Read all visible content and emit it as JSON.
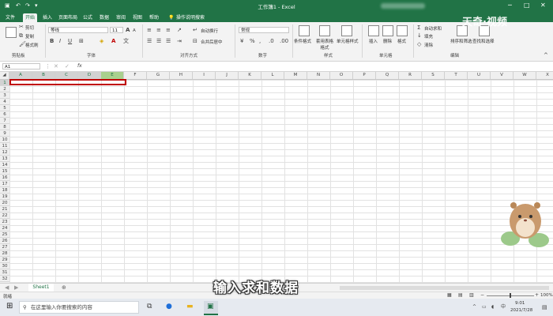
{
  "window": {
    "title": "工作簿1 - Excel"
  },
  "menu": {
    "tabs": [
      "文件",
      "开始",
      "插入",
      "页面布局",
      "公式",
      "数据",
      "审阅",
      "视图",
      "帮助"
    ],
    "active": 1,
    "search_hint": "操作说明搜索"
  },
  "ribbon": {
    "clipboard": {
      "cut": "剪切",
      "copy": "复制",
      "format_painter": "格式刷",
      "label": "剪贴板"
    },
    "font": {
      "name": "等线",
      "size": "11",
      "bold": "B",
      "italic": "I",
      "underline": "U",
      "grow": "A",
      "shrink": "A",
      "label": "字体"
    },
    "alignment": {
      "wrap": "自动换行",
      "merge": "合并后居中",
      "label": "对齐方式"
    },
    "number": {
      "format": "常规",
      "label": "数字"
    },
    "styles": {
      "conditional": "条件格式",
      "table_fmt": "套用表格格式",
      "cell_style": "单元格样式",
      "label": "样式"
    },
    "cells": {
      "insert": "插入",
      "delete": "删除",
      "format": "格式",
      "label": "单元格"
    },
    "editing": {
      "autosum": "自动求和",
      "fill": "填充",
      "clear": "清除",
      "sort": "排序和筛选",
      "find": "查找和选择",
      "label": "编辑"
    }
  },
  "formula_bar": {
    "name_box": "A1",
    "fx": "fx",
    "value": ""
  },
  "columns": [
    "A",
    "B",
    "C",
    "D",
    "E",
    "F",
    "G",
    "H",
    "I",
    "J",
    "K",
    "L",
    "M",
    "N",
    "O",
    "P",
    "Q",
    "R",
    "S",
    "T",
    "U",
    "V",
    "W",
    "X"
  ],
  "selected_columns": [
    "A",
    "B",
    "C",
    "D",
    "E"
  ],
  "rows": [
    "1",
    "2",
    "3",
    "4",
    "5",
    "6",
    "7",
    "8",
    "9",
    "10",
    "11",
    "12",
    "13",
    "14",
    "15",
    "16",
    "17",
    "18",
    "19",
    "20",
    "21",
    "22",
    "23",
    "24",
    "25",
    "26",
    "27",
    "28",
    "29",
    "30",
    "31",
    "32"
  ],
  "sheets": [
    "Sheet1"
  ],
  "status": {
    "ready": "就绪",
    "zoom": "100%"
  },
  "taskbar": {
    "search": "在这里输入你要搜索的内容",
    "time": "9:01",
    "date": "2021/7/28"
  },
  "overlay": {
    "caption": "输入求和数据",
    "watermark": "天奇·视频"
  }
}
